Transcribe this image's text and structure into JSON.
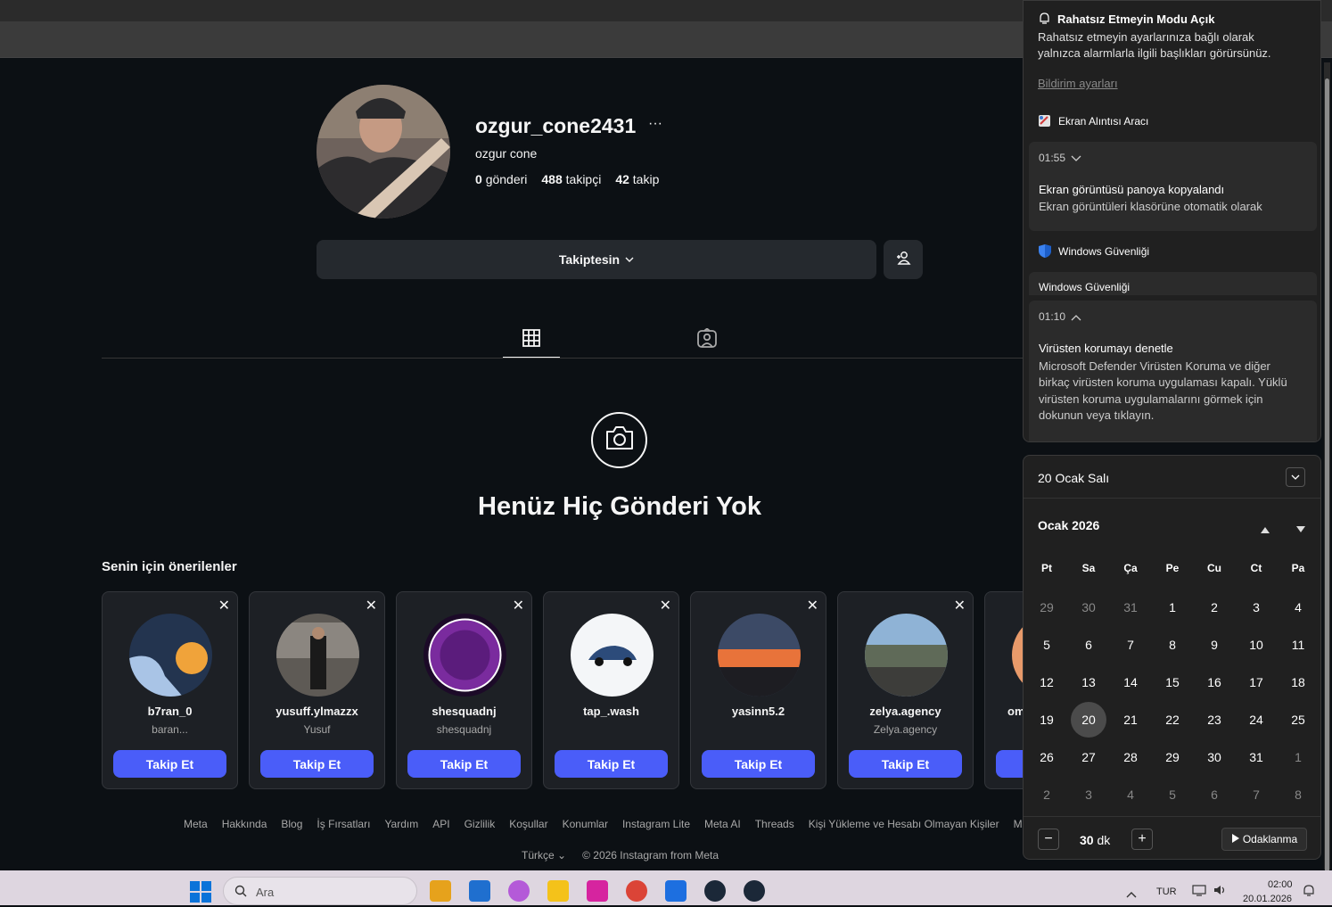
{
  "profile": {
    "username": "ozgur_cone2431",
    "more": "···",
    "full_name": "ozgur cone",
    "posts_count": "0",
    "posts_label": "gönderi",
    "followers_count": "488",
    "followers_label": "takipçi",
    "following_count": "42",
    "following_label": "takip",
    "follow_button": "Takiptesin"
  },
  "empty_state": "Henüz Hiç Gönderi Yok",
  "suggestions": {
    "title": "Senin için önerilenler",
    "button": "Takip Et",
    "close": "✕",
    "items": [
      {
        "name": "b7ran_0",
        "sub": "baran..."
      },
      {
        "name": "yusuff.ylmazzx",
        "sub": "Yusuf"
      },
      {
        "name": "shesquadnj",
        "sub": "shesquadnj"
      },
      {
        "name": "tap_.wash",
        "sub": ""
      },
      {
        "name": "yasinn5.2",
        "sub": ""
      },
      {
        "name": "zelya.agency",
        "sub": "Zelya.agency"
      },
      {
        "name": "om",
        "sub": ""
      }
    ]
  },
  "footer": {
    "links": [
      "Meta",
      "Hakkında",
      "Blog",
      "İş Fırsatları",
      "Yardım",
      "API",
      "Gizlilik",
      "Koşullar",
      "Konumlar",
      "Instagram Lite",
      "Meta AI",
      "Threads",
      "Kişi Yükleme ve Hesabı Olmayan Kişiler",
      "Meta V"
    ],
    "language": "Türkçe",
    "copyright": "© 2026 Instagram from Meta"
  },
  "notifications": {
    "dnd_title": "Rahatsız Etmeyin Modu Açık",
    "dnd_text_1": "Rahatsız etmeyin ayarlarınıza bağlı olarak",
    "dnd_text_2": "yalnızca alarmlarla ilgili başlıkları görürsünüz.",
    "settings_link": "Bildirim ayarları",
    "app1_name": "Ekran Alıntısı Aracı",
    "app1_time": "01:55",
    "app1_title": "Ekran görüntüsü panoya kopyalandı",
    "app1_text": "Ekran görüntüleri klasörüne otomatik olarak",
    "app2_name": "Windows Güvenliği",
    "app2_group": "Windows Güvenliği",
    "app2_time": "01:10",
    "app2_title": "Virüsten korumayı denetle",
    "app2_text_1": "Microsoft Defender Virüsten Koruma ve diğer",
    "app2_text_2": "birkaç virüsten koruma uygulaması kapalı. Yüklü",
    "app2_text_3": "virüsten koruma uygulamalarını görmek için",
    "app2_text_4": "dokunun veya tıklayın."
  },
  "calendar": {
    "date_header": "20 Ocak Salı",
    "month": "Ocak 2026",
    "weekdays": [
      "Pt",
      "Sa",
      "Ça",
      "Pe",
      "Cu",
      "Ct",
      "Pa"
    ],
    "weeks": [
      [
        "29",
        "30",
        "31",
        "1",
        "2",
        "3",
        "4"
      ],
      [
        "5",
        "6",
        "7",
        "8",
        "9",
        "10",
        "11"
      ],
      [
        "12",
        "13",
        "14",
        "15",
        "16",
        "17",
        "18"
      ],
      [
        "19",
        "20",
        "21",
        "22",
        "23",
        "24",
        "25"
      ],
      [
        "26",
        "27",
        "28",
        "29",
        "30",
        "31",
        "1"
      ],
      [
        "2",
        "3",
        "4",
        "5",
        "6",
        "7",
        "8"
      ]
    ],
    "today": "20",
    "focus_minus": "−",
    "focus_value": "30",
    "focus_unit": "dk",
    "focus_plus": "+",
    "focus_button": "Odaklanma"
  },
  "taskbar": {
    "search_placeholder": "Ara",
    "lang": "TUR",
    "time": "02:00",
    "date": "20.01.2026"
  }
}
